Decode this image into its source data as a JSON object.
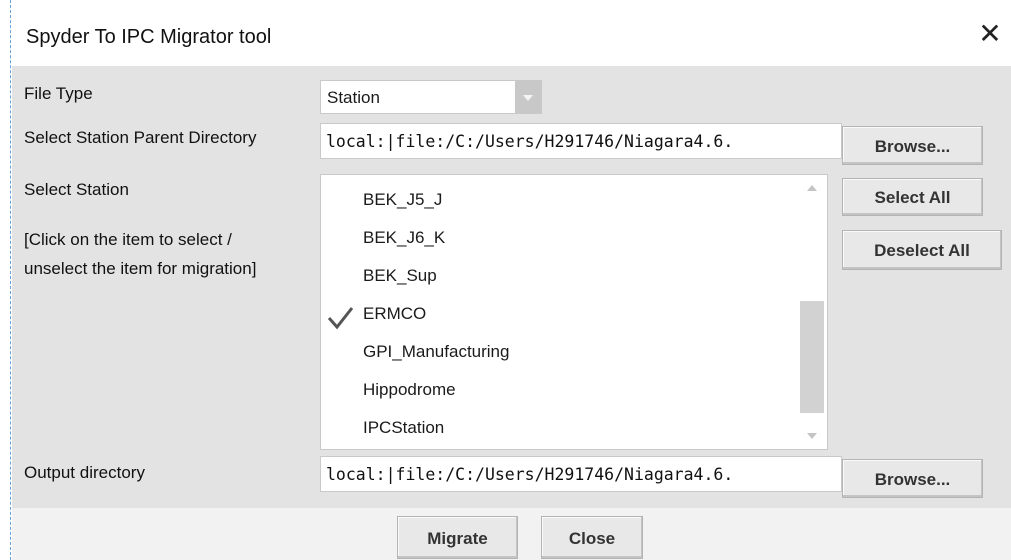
{
  "dialog": {
    "title": "Spyder To IPC Migrator tool",
    "close_glyph": "✕"
  },
  "form": {
    "file_type_label": "File Type",
    "file_type_value": "Station",
    "parent_dir_label": "Select Station Parent Directory",
    "parent_dir_value": "local:|file:/C:/Users/H291746/Niagara4.6.",
    "select_station_label": "Select Station",
    "hint_line1": "[Click on the item to select /",
    "hint_line2": "unselect the item for migration]",
    "output_dir_label": "Output directory",
    "output_dir_value": "local:|file:/C:/Users/H291746/Niagara4.6.",
    "browse_label": "Browse...",
    "select_all_label": "Select All",
    "deselect_all_label": "Deselect All"
  },
  "stations": [
    {
      "name": "BEK_J5_J",
      "checked": false
    },
    {
      "name": "BEK_J6_K",
      "checked": false
    },
    {
      "name": "BEK_Sup",
      "checked": false
    },
    {
      "name": "ERMCO",
      "checked": true
    },
    {
      "name": "GPI_Manufacturing",
      "checked": false
    },
    {
      "name": "Hippodrome",
      "checked": false
    },
    {
      "name": "IPCStation",
      "checked": false
    }
  ],
  "footer": {
    "migrate_label": "Migrate",
    "close_label": "Close"
  },
  "icons": {
    "close": "close-icon",
    "check": "checkmark-icon",
    "dropdown": "chevron-down-icon",
    "scroll_up": "scroll-up-arrow",
    "scroll_down": "scroll-down-arrow"
  }
}
